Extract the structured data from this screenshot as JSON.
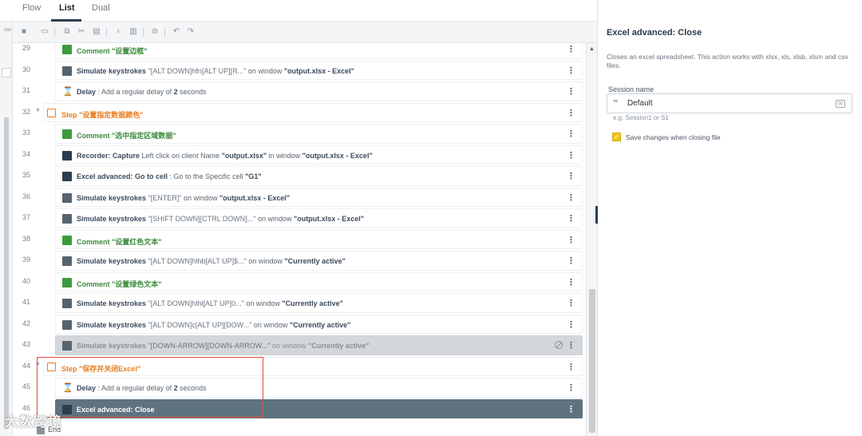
{
  "tabs": [
    {
      "label": "Flow"
    },
    {
      "label": "List",
      "active": true
    },
    {
      "label": "Dual"
    }
  ],
  "left_strip_label": "ow",
  "toolbar_icons": [
    "recorder-icon",
    "screen-icon",
    "copy-icon",
    "cut-icon",
    "paste-icon",
    "enable-icon",
    "delete-icon",
    "disable-icon",
    "undo-icon",
    "redo-icon"
  ],
  "rows": [
    {
      "n": "29",
      "kind": "comment",
      "icon": "comment-icon",
      "kw": "Comment",
      "q1": "\"设置边框\""
    },
    {
      "n": "30",
      "kind": "key",
      "icon": "keyboard-icon",
      "kw": "Simulate keystrokes",
      "q1": "\"[ALT DOWN]hfn[ALT UP][R...\"",
      "mid": " on window ",
      "v1": "\"output.xlsx - Excel\""
    },
    {
      "n": "31",
      "kind": "delay",
      "icon": "hourglass-icon",
      "kw": "Delay",
      "mid": " : Add a regular delay of ",
      "v1": "2",
      "tail": " seconds"
    },
    {
      "n": "32",
      "kind": "step",
      "icon": "step-icon",
      "kw": "Step",
      "q1": "\"设置指定数据颜色\""
    },
    {
      "n": "33",
      "kind": "comment",
      "icon": "comment-icon",
      "kw": "Comment",
      "q1": "\"选中指定区域数据\""
    },
    {
      "n": "34",
      "kind": "rec",
      "icon": "recorder-icon",
      "kw": "Recorder: Capture",
      "mid": " Left click on client Name ",
      "v1": "\"output.xlsx\"",
      "mid2": " in window ",
      "v2": "\"output.xlsx - Excel\""
    },
    {
      "n": "35",
      "kind": "excel",
      "icon": "excel-icon",
      "kw": "Excel advanced: Go to cell",
      "mid": " : Go to the Specific cell ",
      "v1": "\"G1\""
    },
    {
      "n": "36",
      "kind": "key",
      "icon": "keyboard-icon",
      "kw": "Simulate keystrokes",
      "q1": "\"[ENTER]\"",
      "mid": " on window ",
      "v1": "\"output.xlsx - Excel\""
    },
    {
      "n": "37",
      "kind": "key",
      "icon": "keyboard-icon",
      "kw": "Simulate keystrokes",
      "q1": "\"[SHIFT DOWN][CTRL DOWN]...\"",
      "mid": " on window ",
      "v1": "\"output.xlsx - Excel\""
    },
    {
      "n": "38",
      "kind": "comment",
      "icon": "comment-icon",
      "kw": "Comment",
      "q1": "\"设置红色文本\""
    },
    {
      "n": "39",
      "kind": "key",
      "icon": "keyboard-icon",
      "kw": "Simulate keystrokes",
      "q1": "\"[ALT DOWN]hlhb[ALT UP]$...\"",
      "mid": " on window ",
      "v1": "\"Currently active\""
    },
    {
      "n": "40",
      "kind": "comment",
      "icon": "comment-icon",
      "kw": "Comment",
      "q1": "\"设置绿色文本\""
    },
    {
      "n": "41",
      "kind": "key",
      "icon": "keyboard-icon",
      "kw": "Simulate keystrokes",
      "q1": "\"[ALT DOWN]hlhl[ALT UP]0...\"",
      "mid": " on window ",
      "v1": "\"Currently active\""
    },
    {
      "n": "42",
      "kind": "key",
      "icon": "keyboard-icon",
      "kw": "Simulate keystrokes",
      "q1": "\"[ALT DOWN]c[ALT UP][DOW...\"",
      "mid": " on window ",
      "v1": "\"Currently active\""
    },
    {
      "n": "43",
      "kind": "key",
      "icon": "keyboard-icon",
      "kw": "Simulate keystrokes",
      "q1": "\"[DOWN-ARROW][DOWN-ARROW...\"",
      "mid": " on window ",
      "v1": "\"Currently active\"",
      "disabled": true
    },
    {
      "n": "44",
      "kind": "step",
      "icon": "step-icon",
      "kw": "Step",
      "q1": "\"保存并关闭Excel\""
    },
    {
      "n": "45",
      "kind": "delay",
      "icon": "hourglass-icon",
      "kw": "Delay",
      "mid": " : Add a regular delay of ",
      "v1": "2",
      "tail": " seconds"
    },
    {
      "n": "46",
      "kind": "excel",
      "icon": "excel-icon",
      "kw": "Excel advanced: Close",
      "selected": true
    }
  ],
  "end_label": "End",
  "watermark": "大数跨境",
  "panel": {
    "title": "Excel advanced: Close",
    "description": "Closes an excel spreadsheet. This action works with xlsx, xls, xlsb, xlsm and csv files.",
    "session_label": "Session name",
    "session_value": "Default",
    "session_hint": "e.g. Session1 or S1",
    "var_badge": "{x}",
    "save_changes_label": "Save changes when closing file",
    "save_changes_checked": true
  },
  "colors": {
    "step": "#e67e22",
    "comment": "#3d9b3d",
    "selected_row": "#5f7280",
    "checkbox": "#f1c40f",
    "annotation": "#e74c3c"
  }
}
